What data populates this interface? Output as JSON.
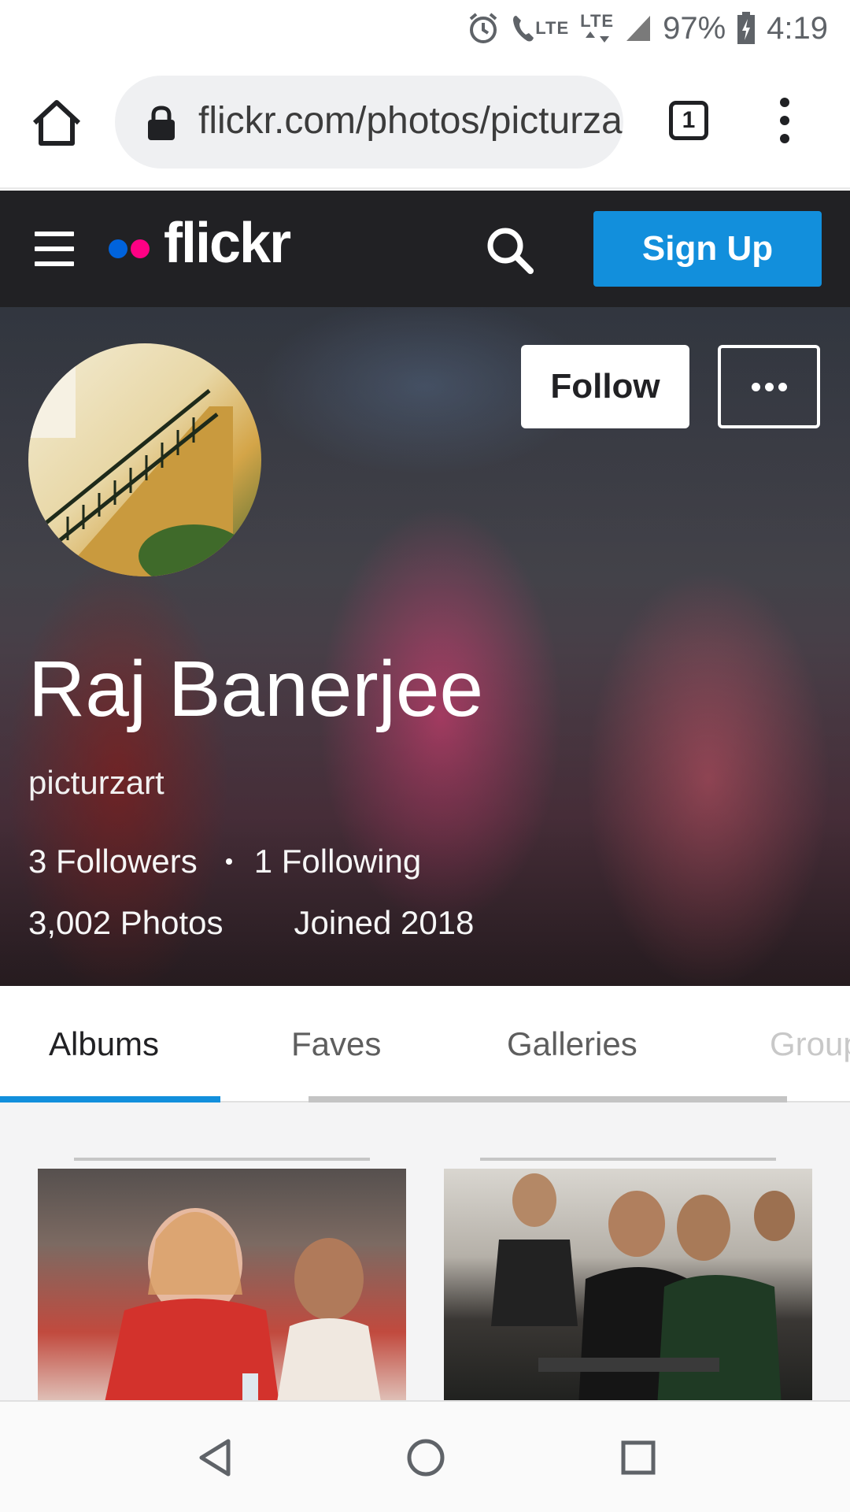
{
  "status_bar": {
    "battery": "97%",
    "time": "4:19",
    "lte_1": "LTE",
    "lte_2": "LTE"
  },
  "browser": {
    "url": "flickr.com/photos/picturzart",
    "tab_count": "1"
  },
  "flickr_header": {
    "logo": "flickr",
    "signup_label": "Sign Up",
    "logo_colors": [
      "#0063dc",
      "#ff0084"
    ]
  },
  "profile": {
    "follow_label": "Follow",
    "name": "Raj Banerjee",
    "username": "picturzart",
    "followers": "3 Followers",
    "following": "1 Following",
    "photos": "3,002 Photos",
    "joined": "Joined 2018"
  },
  "tabs": [
    {
      "label": "Albums"
    },
    {
      "label": "Faves"
    },
    {
      "label": "Galleries"
    },
    {
      "label": "Groups"
    }
  ],
  "colors": {
    "accent": "#128fdc",
    "header_bg": "#212124"
  }
}
